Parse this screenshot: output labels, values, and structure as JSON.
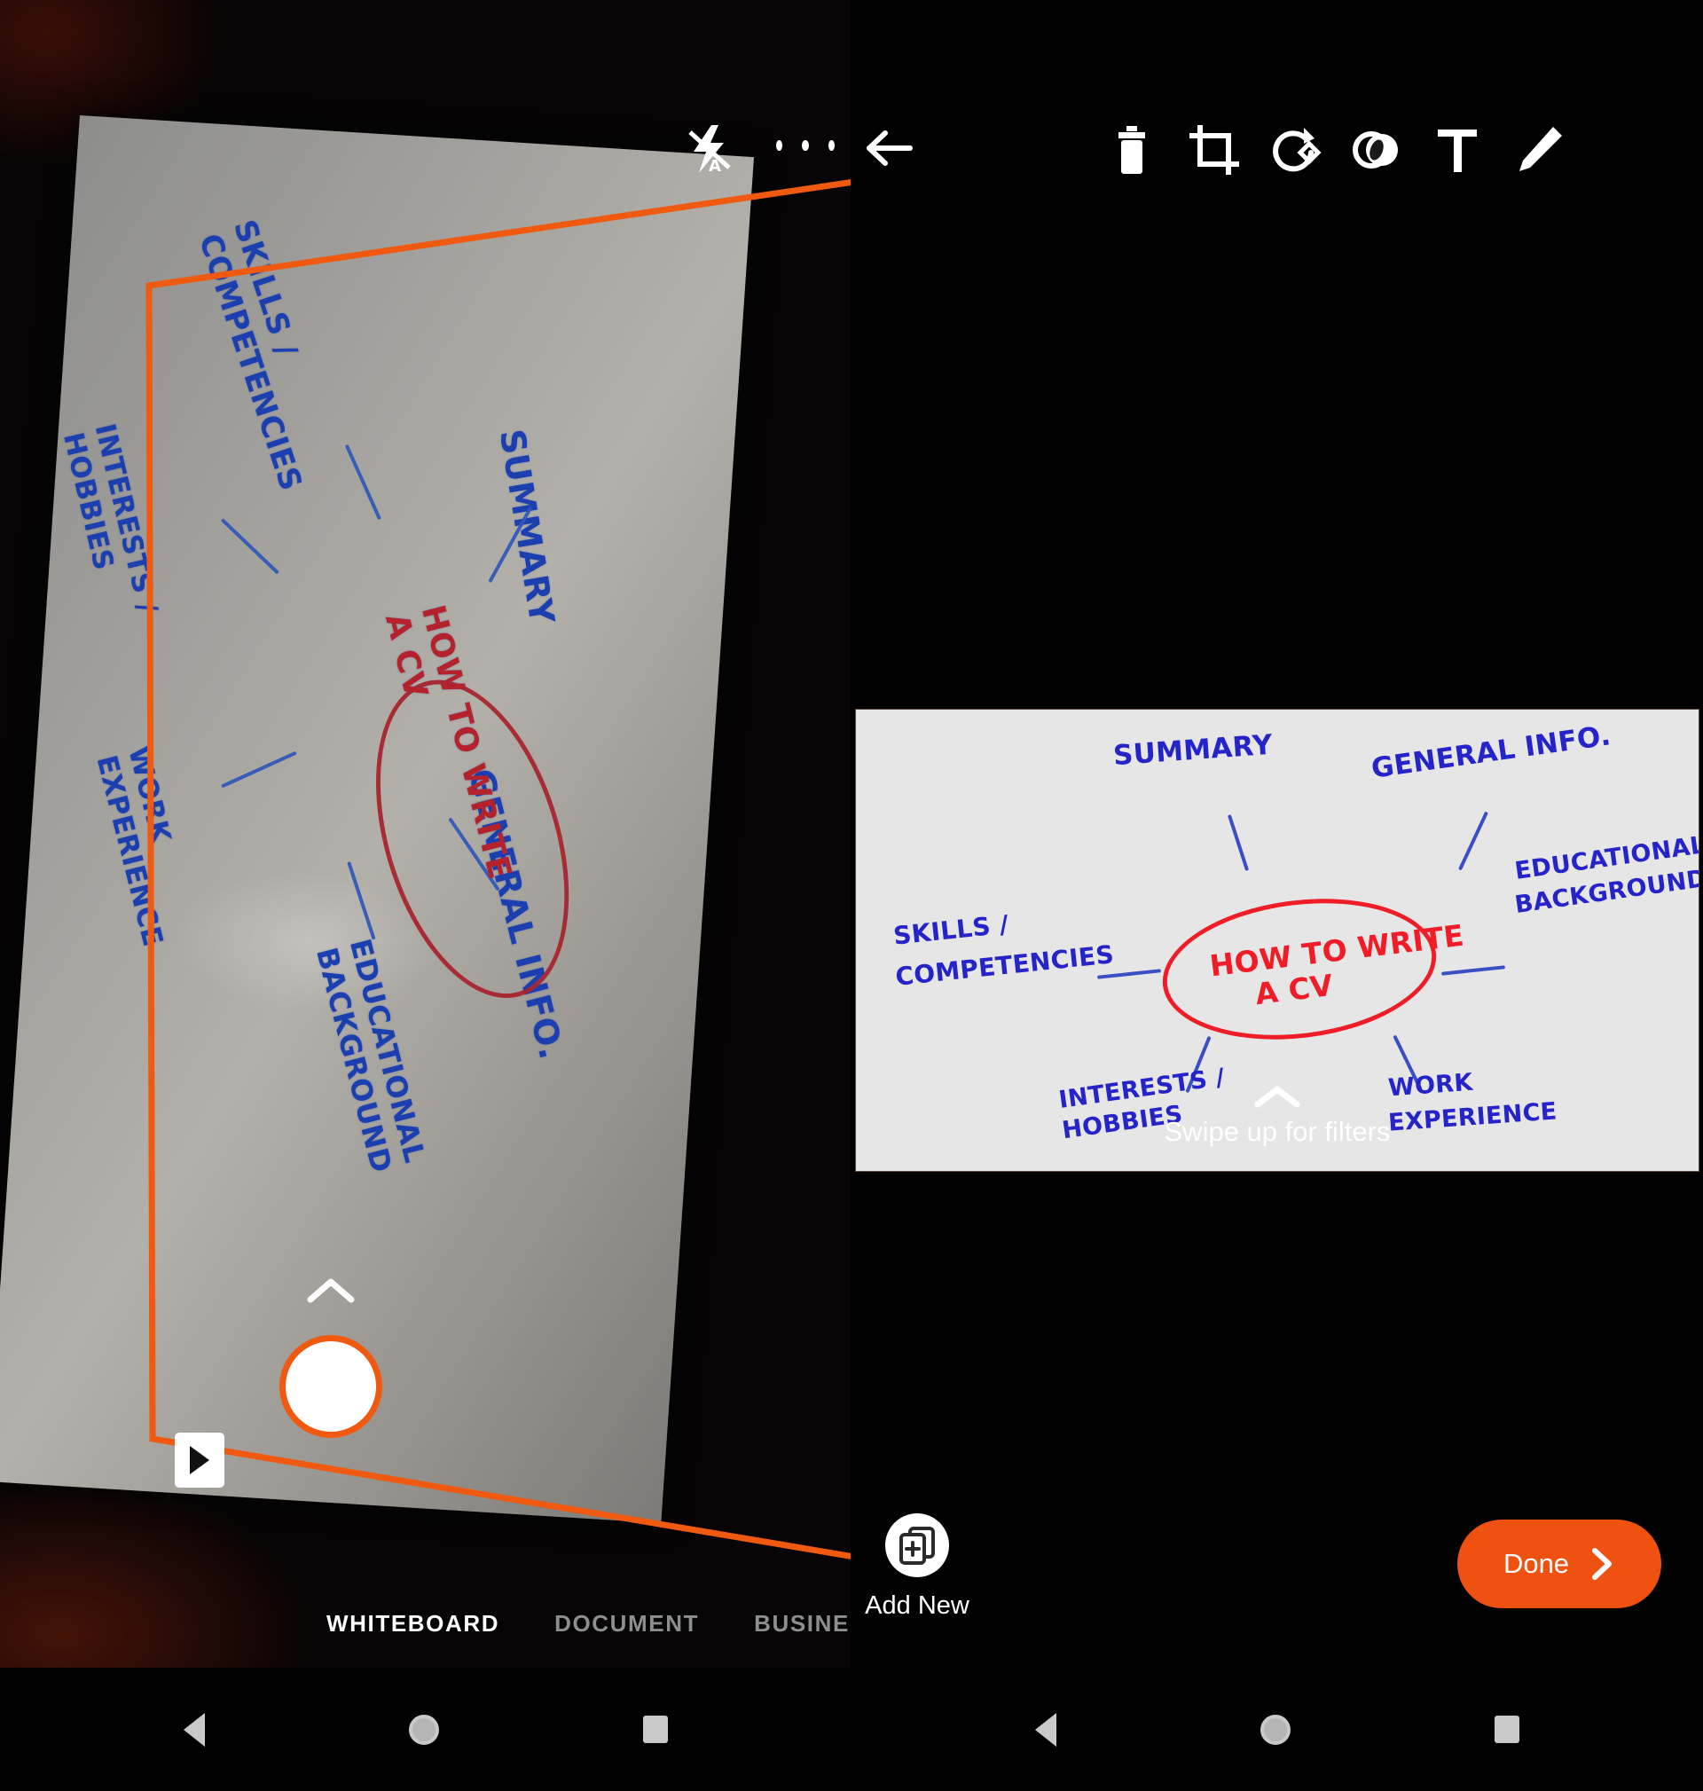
{
  "app": {
    "mode": "whiteboard-scanner",
    "accent_color": "#ee5110",
    "detection_color": "#ef5a10"
  },
  "camera_pane": {
    "topbar": {
      "flash_icon": "flash-auto-off-icon",
      "more_icon": "more-options-icon"
    },
    "shutter_label": "shutter-button",
    "gallery_thumb_label": "gallery-thumbnail",
    "filters_chevron": "chevron-up-icon",
    "modes": [
      {
        "label": "WHITEBOARD",
        "active": true
      },
      {
        "label": "DOCUMENT",
        "active": false
      },
      {
        "label": "BUSINE",
        "active": false
      }
    ],
    "captured_board": {
      "center_line1": "HOW TO WRITE",
      "center_line2": "A CV",
      "branches": [
        "SKILLS /",
        "COMPETENCIES",
        "INTERESTS /",
        "HOBBIES",
        "SUMMARY",
        "WORK",
        "EXPERIENCE",
        "GENERAL INFO.",
        "EDUCATIONAL",
        "BACKGROUND"
      ]
    }
  },
  "editor_pane": {
    "topbar": {
      "back_label": "back-arrow",
      "actions": [
        {
          "name": "delete-icon",
          "label": "Delete"
        },
        {
          "name": "crop-icon",
          "label": "Crop"
        },
        {
          "name": "rotate-icon",
          "label": "Rotate"
        },
        {
          "name": "adjust-icon",
          "label": "Adjust"
        },
        {
          "name": "text-icon",
          "label": "T"
        },
        {
          "name": "pen-icon",
          "label": "Draw"
        }
      ]
    },
    "swipe_hint": "Swipe up for filters",
    "swipe_chevron": "chevron-up-icon",
    "add_new_label": "Add New",
    "add_new_icon": "add-page-icon",
    "done_label": "Done",
    "done_chevron": "chevron-right-icon"
  },
  "mindmap": {
    "title_line1": "HOW TO WRITE",
    "title_line2": "A CV",
    "nodes": [
      {
        "id": "summary",
        "lines": [
          "SUMMARY"
        ]
      },
      {
        "id": "general",
        "lines": [
          "GENERAL INFO."
        ]
      },
      {
        "id": "education",
        "lines": [
          "EDUCATIONAL",
          "BACKGROUND"
        ]
      },
      {
        "id": "work",
        "lines": [
          "WORK",
          "EXPERIENCE"
        ]
      },
      {
        "id": "interests",
        "lines": [
          "INTERESTS /",
          "HOBBIES"
        ]
      },
      {
        "id": "skills",
        "lines": [
          "SKILLS /",
          "COMPETENCIES"
        ]
      }
    ]
  },
  "navbar": {
    "back": "back-triangle-icon",
    "home": "home-circle-icon",
    "recents": "recents-square-icon"
  }
}
